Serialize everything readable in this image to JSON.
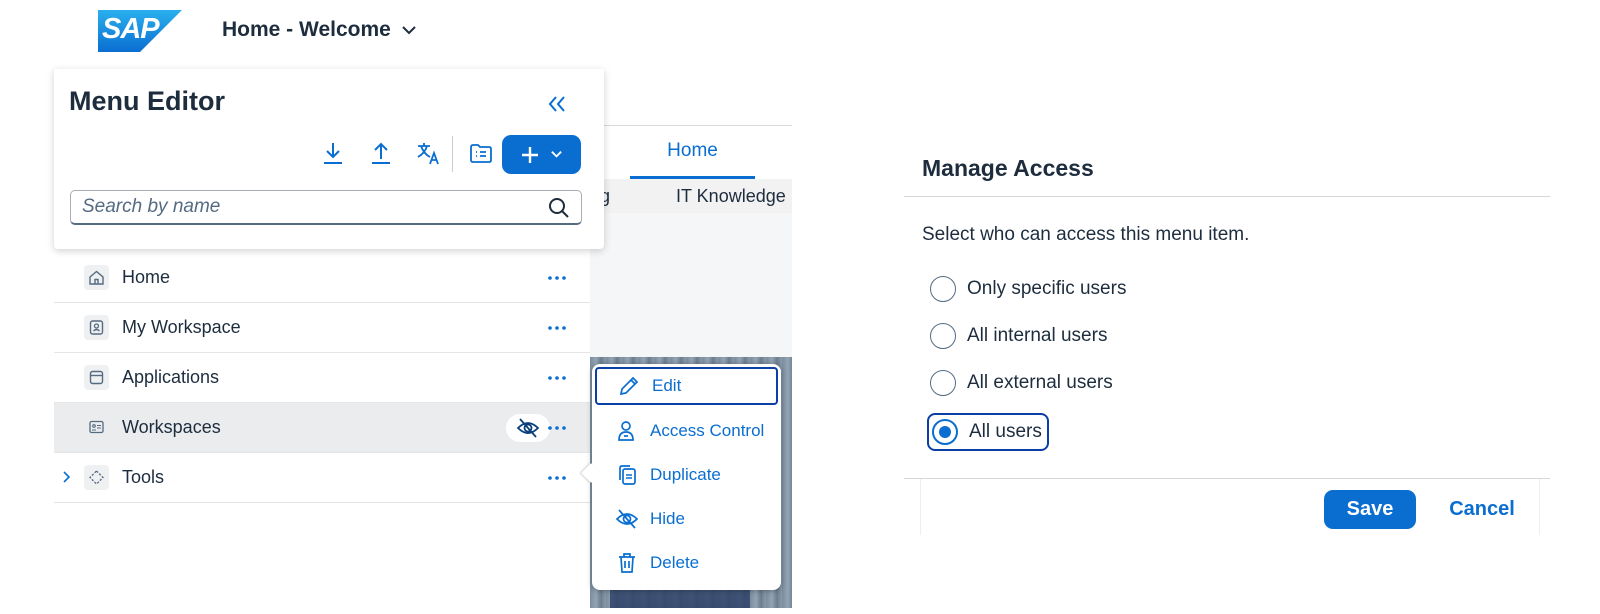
{
  "shell": {
    "logo_text": "SAP",
    "title": "Home - Welcome"
  },
  "background_page": {
    "tab_label": "Home",
    "subnav_partial_left": "ng",
    "subnav_partial_right": "IT Knowledge"
  },
  "menu_editor": {
    "title": "Menu Editor",
    "search_placeholder": "Search by name",
    "items": [
      {
        "label": "Home",
        "icon": "home-icon",
        "hidden": false,
        "expandable": false
      },
      {
        "label": "My Workspace",
        "icon": "workspace-icon",
        "hidden": false,
        "expandable": false
      },
      {
        "label": "Applications",
        "icon": "applications-icon",
        "hidden": false,
        "expandable": false
      },
      {
        "label": "Workspaces",
        "icon": "workspaces-icon",
        "hidden": true,
        "expandable": false
      },
      {
        "label": "Tools",
        "icon": "tools-icon",
        "hidden": false,
        "expandable": true
      }
    ]
  },
  "context_menu": {
    "items": [
      {
        "label": "Edit",
        "icon": "pencil-icon"
      },
      {
        "label": "Access Control",
        "icon": "user-lock-icon"
      },
      {
        "label": "Duplicate",
        "icon": "duplicate-icon"
      },
      {
        "label": "Hide",
        "icon": "eye-slash-icon"
      },
      {
        "label": "Delete",
        "icon": "trash-icon"
      }
    ]
  },
  "manage_access": {
    "title": "Manage Access",
    "description": "Select who can access this menu item.",
    "options": [
      {
        "label": "Only specific users",
        "selected": false
      },
      {
        "label": "All internal users",
        "selected": false
      },
      {
        "label": "All external users",
        "selected": false
      },
      {
        "label": "All users",
        "selected": true
      }
    ],
    "save_label": "Save",
    "cancel_label": "Cancel"
  },
  "colors": {
    "accent": "#0a6ed1",
    "focus": "#0a3fa6",
    "text": "#1d2d3e",
    "sap_logo": "#1a8fd6"
  }
}
